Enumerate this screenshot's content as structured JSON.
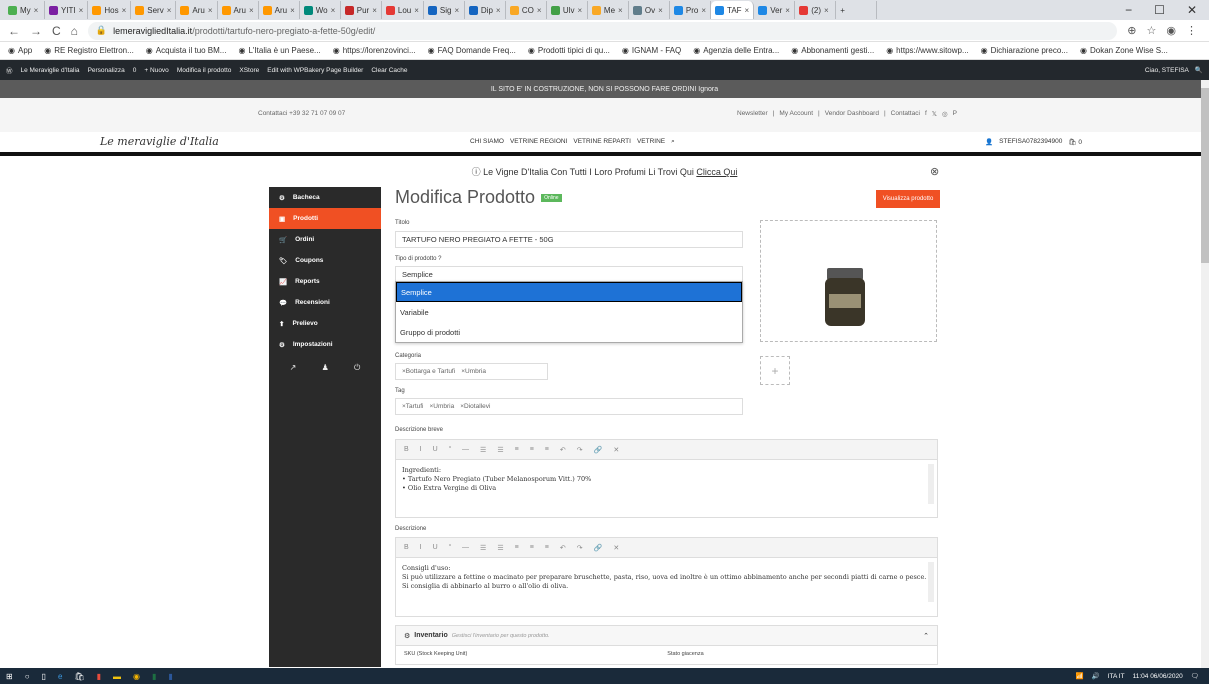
{
  "browser": {
    "tabs": [
      {
        "label": "My",
        "color": "#4caf50"
      },
      {
        "label": "YITI",
        "color": "#7b1fa2"
      },
      {
        "label": "Hos",
        "color": "#ff9800"
      },
      {
        "label": "Serv",
        "color": "#ff9800"
      },
      {
        "label": "Aru",
        "color": "#ff9800"
      },
      {
        "label": "Aru",
        "color": "#ff9800"
      },
      {
        "label": "Aru",
        "color": "#ff9800"
      },
      {
        "label": "Wo",
        "color": "#00897b"
      },
      {
        "label": "Pur",
        "color": "#c62828"
      },
      {
        "label": "Lou",
        "color": "#e53935"
      },
      {
        "label": "Sig",
        "color": "#1565c0"
      },
      {
        "label": "Dip",
        "color": "#1565c0"
      },
      {
        "label": "CO",
        "color": "#f9a825"
      },
      {
        "label": "Ulv",
        "color": "#43a047"
      },
      {
        "label": "Me",
        "color": "#f9a825"
      },
      {
        "label": "Ov",
        "color": "#607d8b"
      },
      {
        "label": "Pro",
        "color": "#1e88e5"
      },
      {
        "label": "TAF",
        "color": "#1e88e5",
        "active": true
      },
      {
        "label": "Ver",
        "color": "#1e88e5"
      },
      {
        "label": "(2)",
        "color": "#e53935"
      }
    ],
    "new_tab": "+",
    "url_host": "lemeravigliedItalia.it",
    "url_path": "/prodotti/tartufo-nero-pregiato-a-fette-50g/edit/",
    "bookmarks": [
      "App",
      "RE Registro Elettron...",
      "Acquista il tuo BM...",
      "L'Italia è un Paese...",
      "https://lorenzovinci...",
      "FAQ Domande Freq...",
      "Prodotti tipici di qu...",
      "IGNAM - FAQ",
      "Agenzia delle Entra...",
      "Abbonamenti gesti...",
      "https://www.sitowp...",
      "Dichiarazione preco...",
      "Dokan Zone Wise S..."
    ]
  },
  "wp_admin": {
    "items": [
      "Le Meraviglie d'Italia",
      "Personalizza",
      "0",
      "+ Nuovo",
      "Modifica il prodotto",
      "XStore",
      "Edit with WPBakery Page Builder",
      "Clear Cache"
    ],
    "greeting": "Ciao, STEFISA"
  },
  "notice": "IL SITO E' IN COSTRUZIONE, NON SI POSSONO FARE ORDINI Ignora",
  "topinfo": {
    "contact": "Contattaci +39 32 71 07 09 07",
    "links": [
      "Newsletter",
      "My Account",
      "Vendor Dashboard",
      "Contattaci"
    ]
  },
  "header": {
    "logo": "Le meraviglie d'Italia",
    "nav": [
      "CHI SIAMO",
      "VETRINE REGIONI",
      "VETRINE REPARTI",
      "VETRINE"
    ],
    "user": "STEFISA0782394900"
  },
  "promo": {
    "text": "Le Vigne D'Italia Con Tutti I Loro Profumi Li Trovi Qui",
    "link": "Clicca Qui"
  },
  "sidebar": {
    "items": [
      "Bacheca",
      "Prodotti",
      "Ordini",
      "Coupons",
      "Reports",
      "Recensioni",
      "Prelievo",
      "Impostazioni"
    ]
  },
  "form": {
    "page_title": "Modifica Prodotto",
    "badge": "Online",
    "view_button": "Visualizza prodotto",
    "title_label": "Titolo",
    "title_value": "TARTUFO NERO PREGIATO A FETTE - 50G",
    "type_label": "Tipo di prodotto",
    "type_value": "Semplice",
    "type_options": [
      "Semplice",
      "Variabile",
      "Gruppo di prodotti"
    ],
    "category_label": "Categoria",
    "categories": [
      "×Bottarga e Tartufi",
      "×Umbria"
    ],
    "tag_label": "Tag",
    "tags": [
      "×Tartufi",
      "×Umbria",
      "×Diotallevi"
    ],
    "short_desc_label": "Descrizione breve",
    "short_desc": [
      "Ingredienti:",
      "• Tartufo Nero Pregiato (Tuber Melanosporum Vitt.) 70%",
      "• Olio Extra Vergine di Oliva"
    ],
    "desc_label": "Descrizione",
    "desc": [
      "Consigli d'uso:",
      "Si può utilizzare a fettine o macinato per preparare bruschette, pasta, riso, uova ed inoltre è un ottimo abbinamento anche per secondi piatti di carne o pesce.",
      "Si consiglia di abbinarlo al burro o all'olio di oliva."
    ],
    "toolbar": [
      "B",
      "I",
      "U",
      "“",
      "—",
      "☰",
      "☰",
      "≡",
      "≡",
      "≡",
      "↶",
      "↷",
      "🔗",
      "✕"
    ],
    "inventory_title": "Inventario",
    "inventory_sub": "Gestisci l'inventario per questo prodotto.",
    "sku_label": "SKU (Stock Keeping Unit)",
    "stock_label": "Stato giacenza"
  },
  "taskbar": {
    "lang": "ITA",
    "lang2": "IT",
    "time": "11:04",
    "date": "06/06/2020"
  }
}
